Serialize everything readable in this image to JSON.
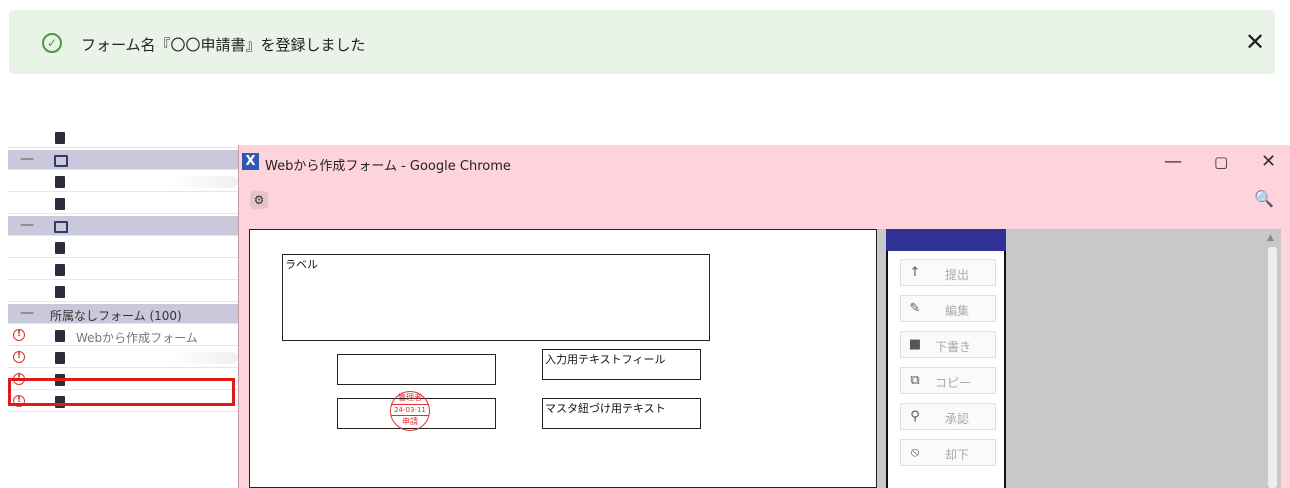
{
  "toast": {
    "message": "フォーム名『〇〇申請書』を登録しました",
    "check_icon": "✓",
    "close_icon": "✕"
  },
  "tree": {
    "rows": [
      {
        "type": "file"
      },
      {
        "type": "group"
      },
      {
        "type": "file"
      },
      {
        "type": "file"
      },
      {
        "type": "group"
      },
      {
        "type": "file"
      },
      {
        "type": "file"
      },
      {
        "type": "file"
      },
      {
        "type": "section",
        "label": "所属なしフォーム (100)"
      },
      {
        "type": "warn-file",
        "label": "Webから作成フォーム"
      },
      {
        "type": "warn-file"
      },
      {
        "type": "warn-file"
      },
      {
        "type": "warn-file"
      }
    ],
    "minus_symbol": "—"
  },
  "window": {
    "logo": "X",
    "title": "Webから作成フォーム - Google Chrome",
    "minimize": "—",
    "maximize": "▢",
    "close": "✕",
    "settings_icon": "⚙",
    "zoom_icon": "🔍"
  },
  "form": {
    "label_box": "ラベル",
    "input_text_label": "入力用テキストフィール",
    "master_text_label": "マスタ紐づけ用テキスト",
    "stamp": {
      "top": "管理者",
      "date": "24-03-11",
      "bottom": "申請"
    }
  },
  "panel": {
    "buttons": [
      {
        "label": "提出",
        "icon": "↑"
      },
      {
        "label": "編集",
        "icon": "✎"
      },
      {
        "label": "下書き",
        "icon": "■"
      },
      {
        "label": "コピー",
        "icon": "⧉"
      },
      {
        "label": "承認",
        "icon": "⚲"
      },
      {
        "label": "却下",
        "icon": "⦸"
      }
    ]
  },
  "colors": {
    "accent_header": "#2f3294",
    "highlight": "#e01a1a",
    "toast_bg": "#e9f3e7",
    "window_title_bg": "#ffd3db"
  }
}
